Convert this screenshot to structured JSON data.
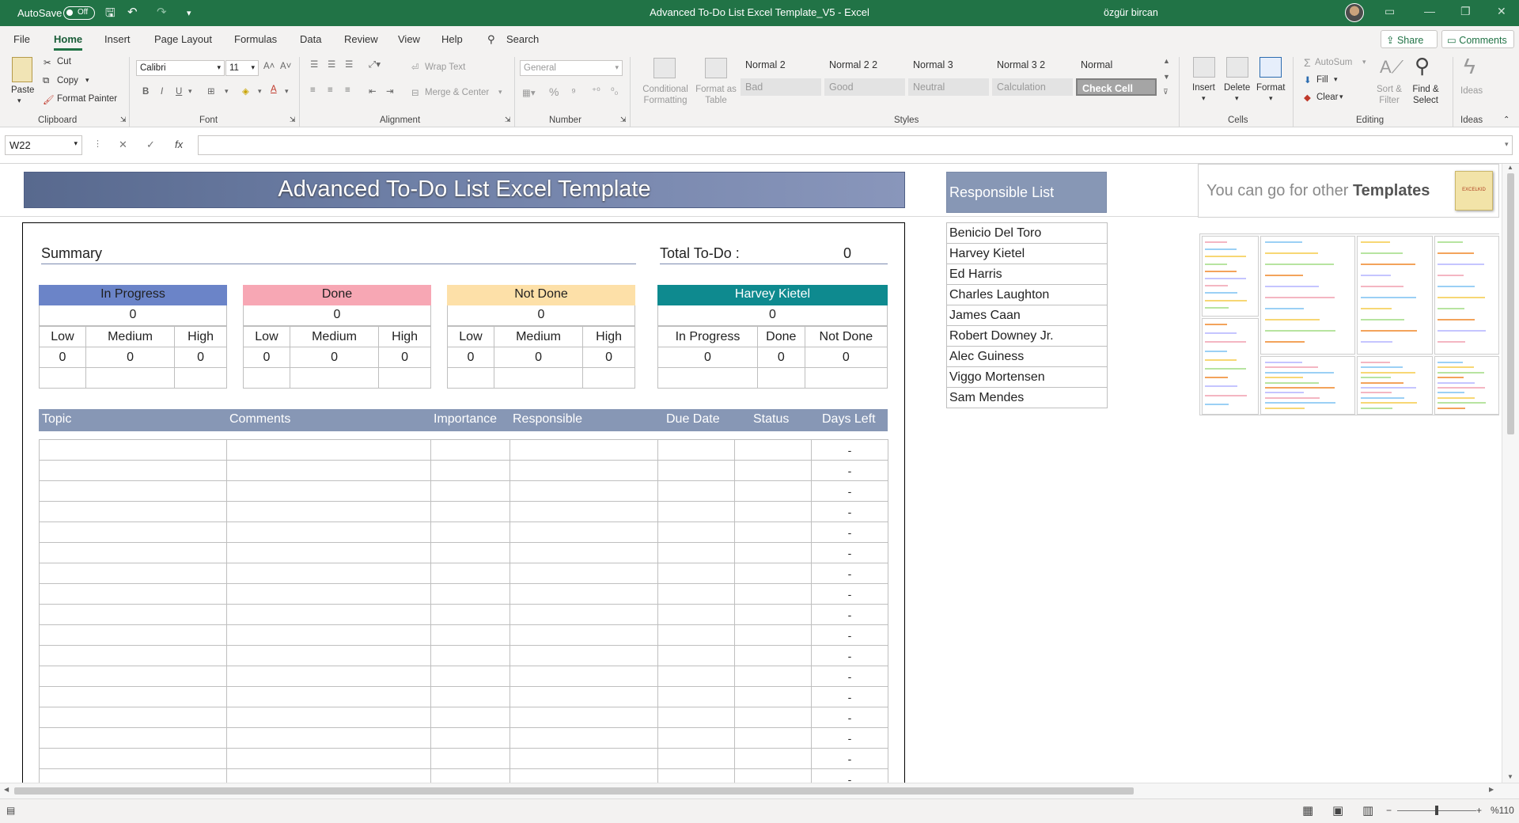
{
  "titlebar": {
    "autosave_label": "AutoSave",
    "autosave_state": "Off",
    "doc_title": "Advanced To-Do List Excel Template_V5  -  Excel",
    "user": "özgür bircan"
  },
  "tabs": [
    "File",
    "Home",
    "Insert",
    "Page Layout",
    "Formulas",
    "Data",
    "Review",
    "View",
    "Help"
  ],
  "search_label": "Search",
  "share_label": "Share",
  "comments_label": "Comments",
  "ribbon": {
    "paste": "Paste",
    "cut": "Cut",
    "copy": "Copy",
    "format_painter": "Format Painter",
    "font_name": "Calibri",
    "font_size": "11",
    "wrap_text": "Wrap Text",
    "merge_center": "Merge & Center",
    "number_format": "General",
    "conditional_formatting": "Conditional Formatting",
    "format_as_table": "Format as Table",
    "styles": [
      {
        "label": "Normal 2",
        "bg": "#f3f2f1",
        "fg": "#333"
      },
      {
        "label": "Normal 2 2",
        "bg": "#f3f2f1",
        "fg": "#333"
      },
      {
        "label": "Normal 3",
        "bg": "#f3f2f1",
        "fg": "#333"
      },
      {
        "label": "Normal 3 2",
        "bg": "#f3f2f1",
        "fg": "#333"
      },
      {
        "label": "Normal",
        "bg": "#f3f2f1",
        "fg": "#333"
      },
      {
        "label": "Bad",
        "bg": "#e3e3e3",
        "fg": "#9a9a9a"
      },
      {
        "label": "Good",
        "bg": "#e3e3e3",
        "fg": "#9a9a9a"
      },
      {
        "label": "Neutral",
        "bg": "#e3e3e3",
        "fg": "#9a9a9a"
      },
      {
        "label": "Calculation",
        "bg": "#e3e3e3",
        "fg": "#9a9a9a"
      },
      {
        "label": "Check Cell",
        "bg": "#a5a5a5",
        "fg": "#ffffff"
      }
    ],
    "insert": "Insert",
    "delete": "Delete",
    "format": "Format",
    "autosum": "AutoSum",
    "fill": "Fill",
    "clear": "Clear",
    "sort_filter": "Sort & Filter",
    "find_select": "Find & Select",
    "ideas": "Ideas",
    "groups": [
      "Clipboard",
      "Font",
      "Alignment",
      "Number",
      "Styles",
      "Cells",
      "Editing",
      "Ideas"
    ]
  },
  "formula_bar": {
    "name_box": "W22",
    "formula": ""
  },
  "sheet": {
    "title": "Advanced To-Do List Excel Template",
    "summary_label": "Summary",
    "total_label": "Total To-Do :",
    "total_value": "0",
    "boxes": [
      {
        "title": "In Progress",
        "total": "0",
        "cols": [
          "Low",
          "Medium",
          "High"
        ],
        "vals": [
          "0",
          "0",
          "0"
        ],
        "bg": "#6b84c8",
        "fg": "#1f1f1f"
      },
      {
        "title": "Done",
        "total": "0",
        "cols": [
          "Low",
          "Medium",
          "High"
        ],
        "vals": [
          "0",
          "0",
          "0"
        ],
        "bg": "#f7a7b4",
        "fg": "#1f1f1f"
      },
      {
        "title": "Not Done",
        "total": "0",
        "cols": [
          "Low",
          "Medium",
          "High"
        ],
        "vals": [
          "0",
          "0",
          "0"
        ],
        "bg": "#fde0a8",
        "fg": "#1f1f1f"
      },
      {
        "title": "Harvey Kietel",
        "total": "0",
        "cols": [
          "In Progress",
          "Done",
          "Not Done"
        ],
        "vals": [
          "0",
          "0",
          "0"
        ],
        "bg": "#0e8a8f",
        "fg": "#ffffff"
      }
    ],
    "table_headers": [
      "Topic",
      "Comments",
      "Importance",
      "Responsible",
      "Due Date",
      "Status",
      "Days Left"
    ],
    "days_left_placeholder": "-",
    "responsible_header": "Responsible List",
    "responsible": [
      "Benicio Del Toro",
      "Harvey Kietel",
      "Ed Harris",
      "Charles Laughton",
      "James Caan",
      "Robert Downey Jr.",
      "Alec Guiness",
      "Viggo Mortensen",
      "Sam Mendes"
    ],
    "other_templates_pre": "You can go for other ",
    "other_templates_bold": "Templates",
    "logo_text": "EXCELKID"
  },
  "status": {
    "zoom": "%110"
  }
}
